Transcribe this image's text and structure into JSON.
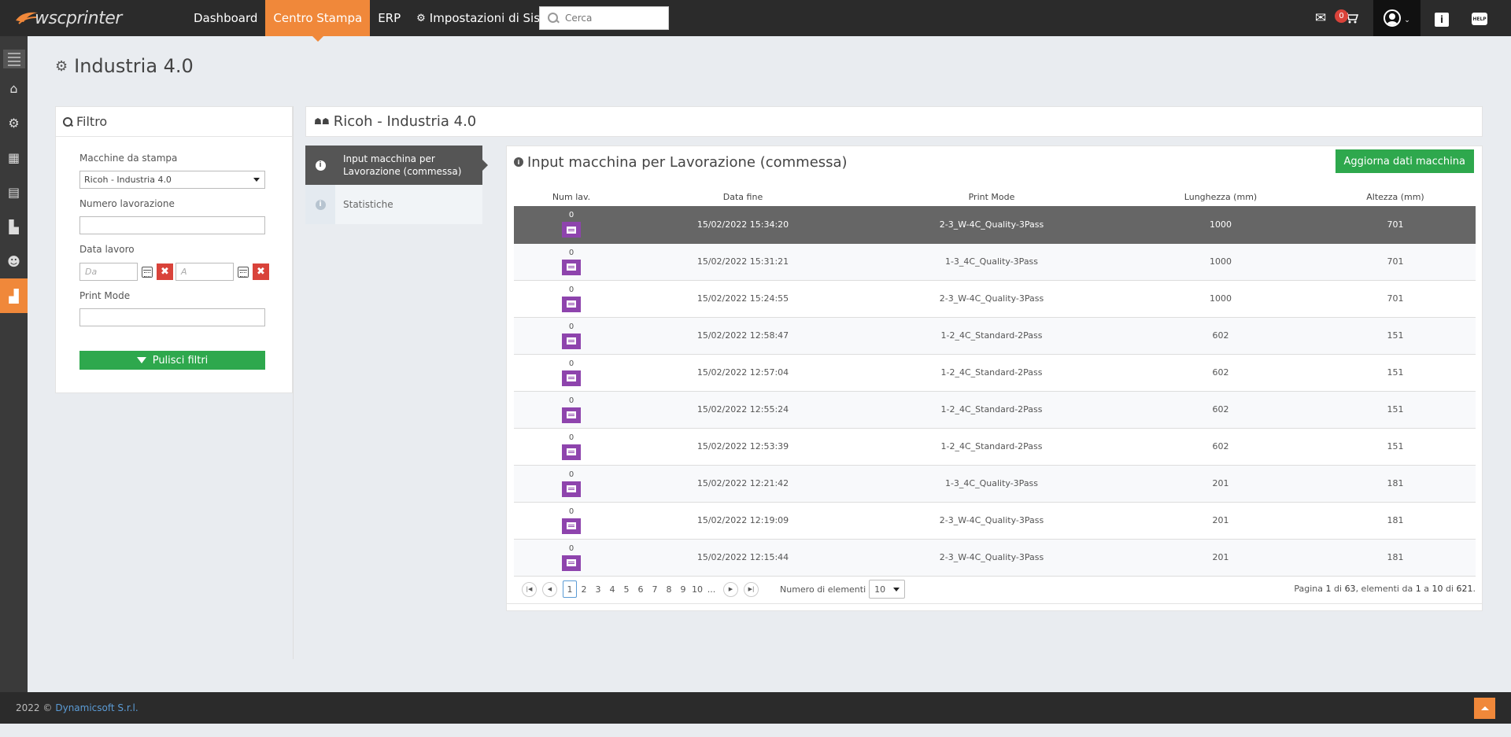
{
  "header": {
    "logo_text": "wscprinter",
    "nav": [
      {
        "label": "Dashboard"
      },
      {
        "label": "Centro Stampa"
      },
      {
        "label": "ERP"
      },
      {
        "label": "Impostazioni di Sistema"
      }
    ],
    "search_placeholder": "Cerca",
    "cart_count": "0",
    "info_label": "i",
    "help_label": "HELP"
  },
  "page": {
    "title": "Industria 4.0"
  },
  "filter": {
    "title": "Filtro",
    "macchine_label": "Macchine da stampa",
    "macchine_value": "Ricoh - Industria 4.0",
    "numero_label": "Numero lavorazione",
    "numero_value": "",
    "data_label": "Data lavoro",
    "data_da_placeholder": "Da",
    "data_a_placeholder": "A",
    "printmode_label": "Print Mode",
    "printmode_value": "",
    "clear_button": "Pulisci filtri"
  },
  "main": {
    "title": "Ricoh - Industria 4.0",
    "tabs": [
      {
        "label": "Input macchina per Lavorazione (commessa)"
      },
      {
        "label": "Statistiche"
      }
    ],
    "content_title": "Input macchina per Lavorazione (commessa)",
    "update_button": "Aggiorna dati macchina",
    "columns": [
      "Num lav.",
      "Data fine",
      "Print Mode",
      "Lunghezza (mm)",
      "Altezza (mm)"
    ],
    "rows": [
      {
        "num": "0",
        "data": "15/02/2022 15:34:20",
        "mode": "2-3_W-4C_Quality-3Pass",
        "len": "1000",
        "alt": "701"
      },
      {
        "num": "0",
        "data": "15/02/2022 15:31:21",
        "mode": "1-3_4C_Quality-3Pass",
        "len": "1000",
        "alt": "701"
      },
      {
        "num": "0",
        "data": "15/02/2022 15:24:55",
        "mode": "2-3_W-4C_Quality-3Pass",
        "len": "1000",
        "alt": "701"
      },
      {
        "num": "0",
        "data": "15/02/2022 12:58:47",
        "mode": "1-2_4C_Standard-2Pass",
        "len": "602",
        "alt": "151"
      },
      {
        "num": "0",
        "data": "15/02/2022 12:57:04",
        "mode": "1-2_4C_Standard-2Pass",
        "len": "602",
        "alt": "151"
      },
      {
        "num": "0",
        "data": "15/02/2022 12:55:24",
        "mode": "1-2_4C_Standard-2Pass",
        "len": "602",
        "alt": "151"
      },
      {
        "num": "0",
        "data": "15/02/2022 12:53:39",
        "mode": "1-2_4C_Standard-2Pass",
        "len": "602",
        "alt": "151"
      },
      {
        "num": "0",
        "data": "15/02/2022 12:21:42",
        "mode": "1-3_4C_Quality-3Pass",
        "len": "201",
        "alt": "181"
      },
      {
        "num": "0",
        "data": "15/02/2022 12:19:09",
        "mode": "2-3_W-4C_Quality-3Pass",
        "len": "201",
        "alt": "181"
      },
      {
        "num": "0",
        "data": "15/02/2022 12:15:44",
        "mode": "2-3_W-4C_Quality-3Pass",
        "len": "201",
        "alt": "181"
      }
    ],
    "pager": {
      "pages": [
        "1",
        "2",
        "3",
        "4",
        "5",
        "6",
        "7",
        "8",
        "9",
        "10"
      ],
      "ellipsis": "...",
      "page_size_label": "Numero di elementi",
      "page_size_value": "10",
      "info_prefix": "Pagina",
      "current_page": "1",
      "info_di": "di",
      "total_pages": "63",
      "info_elementi": ", elementi da",
      "from": "1",
      "info_a": "a",
      "to": "10",
      "info_di2": "di",
      "total": "621",
      "info_end": "."
    }
  },
  "footer": {
    "copy": "2022 ©",
    "company": "Dynamicsoft S.r.l."
  },
  "colors": {
    "accent": "#f0883a",
    "green": "#2ea84d",
    "danger": "#d9433a",
    "purple": "#8e44ad",
    "topbar": "#2b2b2b"
  }
}
